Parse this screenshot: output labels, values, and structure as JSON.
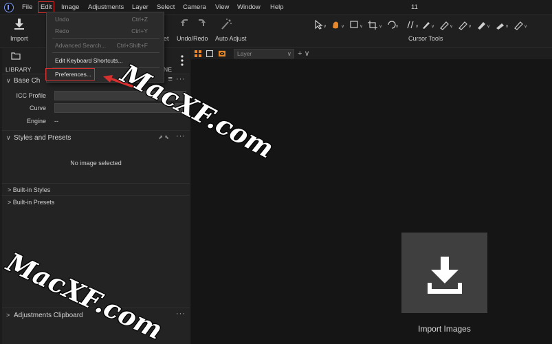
{
  "menubar": {
    "items": [
      "File",
      "Edit",
      "Image",
      "Adjustments",
      "Layer",
      "Select",
      "Camera",
      "View",
      "Window",
      "Help"
    ],
    "counter": "11"
  },
  "toolbar": {
    "import_label": "Import",
    "reset_label_partial": "et",
    "undo_redo_label": "Undo/Redo",
    "auto_adjust_label": "Auto Adjust",
    "cursor_tools_label": "Cursor Tools"
  },
  "left_panel": {
    "tabs": {
      "library_label": "LIBRARY",
      "right_partial_label": "NE"
    },
    "base_characteristics": {
      "title_partial": "Base Ch",
      "icc_profile_label": "ICC Profile",
      "curve_label": "Curve",
      "engine_label": "Engine",
      "engine_value": "--"
    },
    "styles_presets": {
      "title": "Styles and Presets",
      "empty_message": "No image selected",
      "built_in_styles": "Built-in Styles",
      "built_in_presets": "Built-in Presets"
    },
    "adjustments_clipboard": {
      "title": "Adjustments Clipboard"
    }
  },
  "viewer": {
    "layer_placeholder": "Layer",
    "import_images_label": "Import Images"
  },
  "edit_menu": {
    "undo": {
      "label": "Undo",
      "shortcut": "Ctrl+Z"
    },
    "redo": {
      "label": "Redo",
      "shortcut": "Ctrl+Y"
    },
    "advanced_search": {
      "label": "Advanced Search...",
      "shortcut": "Ctrl+Shift+F"
    },
    "edit_shortcuts": {
      "label": "Edit Keyboard Shortcuts..."
    },
    "preferences": {
      "label": "Preferences..."
    }
  },
  "watermarks": [
    "MacXF.com",
    "MacXF.com"
  ],
  "colors": {
    "annotation_red": "#d8312f",
    "accent_orange": "#e8872a",
    "logo_blue": "#7b9cff"
  }
}
